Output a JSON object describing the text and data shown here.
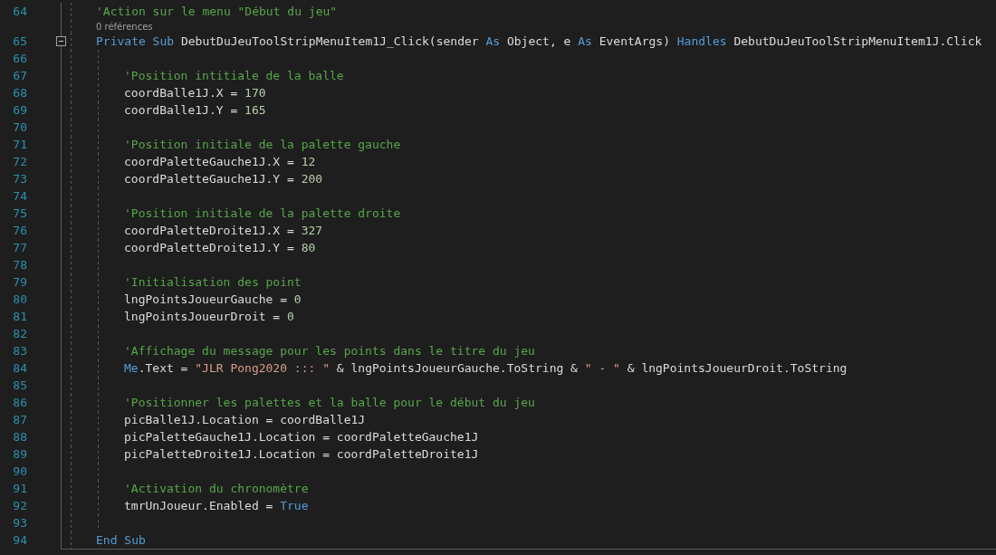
{
  "editor": {
    "lines": [
      {
        "number": "64",
        "tokens": [
          {
            "kind": "comment",
            "text": "'Action sur le menu \"Début du jeu\""
          }
        ]
      },
      {
        "number": "65",
        "codelens": "0 références",
        "expanded": true,
        "tokens": [
          {
            "kind": "keyword",
            "text": "Private Sub"
          },
          {
            "kind": "plain",
            "text": " DebutDuJeuToolStripMenuItem1J_Click(sender "
          },
          {
            "kind": "keyword",
            "text": "As"
          },
          {
            "kind": "plain",
            "text": " Object, e "
          },
          {
            "kind": "keyword",
            "text": "As"
          },
          {
            "kind": "plain",
            "text": " EventArgs) "
          },
          {
            "kind": "keyword",
            "text": "Handles"
          },
          {
            "kind": "plain",
            "text": " DebutDuJeuToolStripMenuItem1J.Click"
          }
        ],
        "children": [
          {
            "number": "66"
          },
          {
            "number": "67",
            "tokens": [
              {
                "kind": "comment",
                "text": "'Position intitiale de la balle"
              }
            ]
          },
          {
            "number": "68",
            "tokens": [
              {
                "kind": "plain",
                "text": "coordBalle1J.X = "
              },
              {
                "kind": "number",
                "text": "170"
              }
            ]
          },
          {
            "number": "69",
            "tokens": [
              {
                "kind": "plain",
                "text": "coordBalle1J.Y = "
              },
              {
                "kind": "number",
                "text": "165"
              }
            ]
          },
          {
            "number": "70"
          },
          {
            "number": "71",
            "tokens": [
              {
                "kind": "comment",
                "text": "'Position initiale de la palette gauche"
              }
            ]
          },
          {
            "number": "72",
            "tokens": [
              {
                "kind": "plain",
                "text": "coordPaletteGauche1J.X = "
              },
              {
                "kind": "number",
                "text": "12"
              }
            ]
          },
          {
            "number": "73",
            "tokens": [
              {
                "kind": "plain",
                "text": "coordPaletteGauche1J.Y = "
              },
              {
                "kind": "number",
                "text": "200"
              }
            ]
          },
          {
            "number": "74"
          },
          {
            "number": "75",
            "tokens": [
              {
                "kind": "comment",
                "text": "'Position initiale de la palette droite"
              }
            ]
          },
          {
            "number": "76",
            "tokens": [
              {
                "kind": "plain",
                "text": "coordPaletteDroite1J.X = "
              },
              {
                "kind": "number",
                "text": "327"
              }
            ]
          },
          {
            "number": "77",
            "tokens": [
              {
                "kind": "plain",
                "text": "coordPaletteDroite1J.Y = "
              },
              {
                "kind": "number",
                "text": "80"
              }
            ]
          },
          {
            "number": "78"
          },
          {
            "number": "79",
            "tokens": [
              {
                "kind": "comment",
                "text": "'Initialisation des point"
              }
            ]
          },
          {
            "number": "80",
            "tokens": [
              {
                "kind": "plain",
                "text": "lngPointsJoueurGauche = "
              },
              {
                "kind": "number",
                "text": "0"
              }
            ]
          },
          {
            "number": "81",
            "tokens": [
              {
                "kind": "plain",
                "text": "lngPointsJoueurDroit = "
              },
              {
                "kind": "number",
                "text": "0"
              }
            ]
          },
          {
            "number": "82"
          },
          {
            "number": "83",
            "tokens": [
              {
                "kind": "comment",
                "text": "'Affichage du message pour les points dans le titre du jeu"
              }
            ]
          },
          {
            "number": "84",
            "tokens": [
              {
                "kind": "keyword",
                "text": "Me"
              },
              {
                "kind": "plain",
                "text": ".Text = "
              },
              {
                "kind": "string",
                "text": "\"JLR Pong2020 ::: \""
              },
              {
                "kind": "plain",
                "text": " & lngPointsJoueurGauche.ToString & "
              },
              {
                "kind": "string",
                "text": "\" - \""
              },
              {
                "kind": "plain",
                "text": " & lngPointsJoueurDroit.ToString"
              }
            ]
          },
          {
            "number": "85"
          },
          {
            "number": "86",
            "tokens": [
              {
                "kind": "comment",
                "text": "'Positionner les palettes et la balle pour le début du jeu"
              }
            ]
          },
          {
            "number": "87",
            "tokens": [
              {
                "kind": "plain",
                "text": "picBalle1J.Location = coordBalle1J"
              }
            ]
          },
          {
            "number": "88",
            "tokens": [
              {
                "kind": "plain",
                "text": "picPaletteGauche1J.Location = coordPaletteGauche1J"
              }
            ]
          },
          {
            "number": "89",
            "tokens": [
              {
                "kind": "plain",
                "text": "picPaletteDroite1J.Location = coordPaletteDroite1J"
              }
            ]
          },
          {
            "number": "90"
          },
          {
            "number": "91",
            "tokens": [
              {
                "kind": "comment",
                "text": "'Activation du chronomètre"
              }
            ]
          },
          {
            "number": "92",
            "tokens": [
              {
                "kind": "plain",
                "text": "tmrUnJoueur.Enabled = "
              },
              {
                "kind": "keyword",
                "text": "True"
              }
            ]
          },
          {
            "number": "93"
          }
        ]
      },
      {
        "number": "94",
        "tokens": [
          {
            "kind": "keyword",
            "text": "End Sub"
          }
        ]
      }
    ]
  }
}
